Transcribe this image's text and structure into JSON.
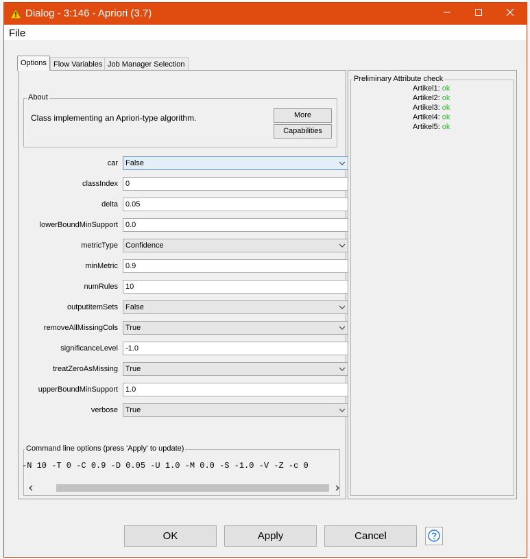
{
  "window": {
    "title": "Dialog - 3:146 - Apriori (3.7)"
  },
  "menu": {
    "file": "File"
  },
  "tabs": [
    {
      "label": "Options",
      "active": true
    },
    {
      "label": "Flow Variables"
    },
    {
      "label": "Job Manager Selection"
    }
  ],
  "about": {
    "legend": "About",
    "text": "Class implementing an Apriori-type algorithm.",
    "more_label": "More",
    "capabilities_label": "Capabilities"
  },
  "params": [
    {
      "label": "car",
      "value": "False",
      "type": "select"
    },
    {
      "label": "classIndex",
      "value": "0",
      "type": "text"
    },
    {
      "label": "delta",
      "value": "0.05",
      "type": "text"
    },
    {
      "label": "lowerBoundMinSupport",
      "value": "0.0",
      "type": "text"
    },
    {
      "label": "metricType",
      "value": "Confidence",
      "type": "select"
    },
    {
      "label": "minMetric",
      "value": "0.9",
      "type": "text"
    },
    {
      "label": "numRules",
      "value": "10",
      "type": "text"
    },
    {
      "label": "outputItemSets",
      "value": "False",
      "type": "select"
    },
    {
      "label": "removeAllMissingCols",
      "value": "True",
      "type": "select"
    },
    {
      "label": "significanceLevel",
      "value": "-1.0",
      "type": "text"
    },
    {
      "label": "treatZeroAsMissing",
      "value": "True",
      "type": "select"
    },
    {
      "label": "upperBoundMinSupport",
      "value": "1.0",
      "type": "text"
    },
    {
      "label": "verbose",
      "value": "True",
      "type": "select"
    }
  ],
  "cmd": {
    "legend": "Command line options (press 'Apply' to update)",
    "text": "-N 10 -T 0 -C 0.9 -D 0.05 -U 1.0 -M 0.0 -S -1.0 -V -Z -c 0"
  },
  "attr_check": {
    "legend": "Preliminary Attribute check",
    "items": [
      {
        "name": "Artikel1:",
        "status": "ok"
      },
      {
        "name": "Artikel2:",
        "status": "ok"
      },
      {
        "name": "Artikel3:",
        "status": "ok"
      },
      {
        "name": "Artikel4:",
        "status": "ok"
      },
      {
        "name": "Artikel5:",
        "status": "ok"
      }
    ]
  },
  "buttons": {
    "ok": "OK",
    "apply": "Apply",
    "cancel": "Cancel"
  },
  "colors": {
    "titlebar": "#e04b10",
    "ok_status": "#1fbf1f",
    "focus": "#5c8fc6"
  },
  "icons": {
    "window": "warning-triangle-icon",
    "help": "question-icon"
  }
}
